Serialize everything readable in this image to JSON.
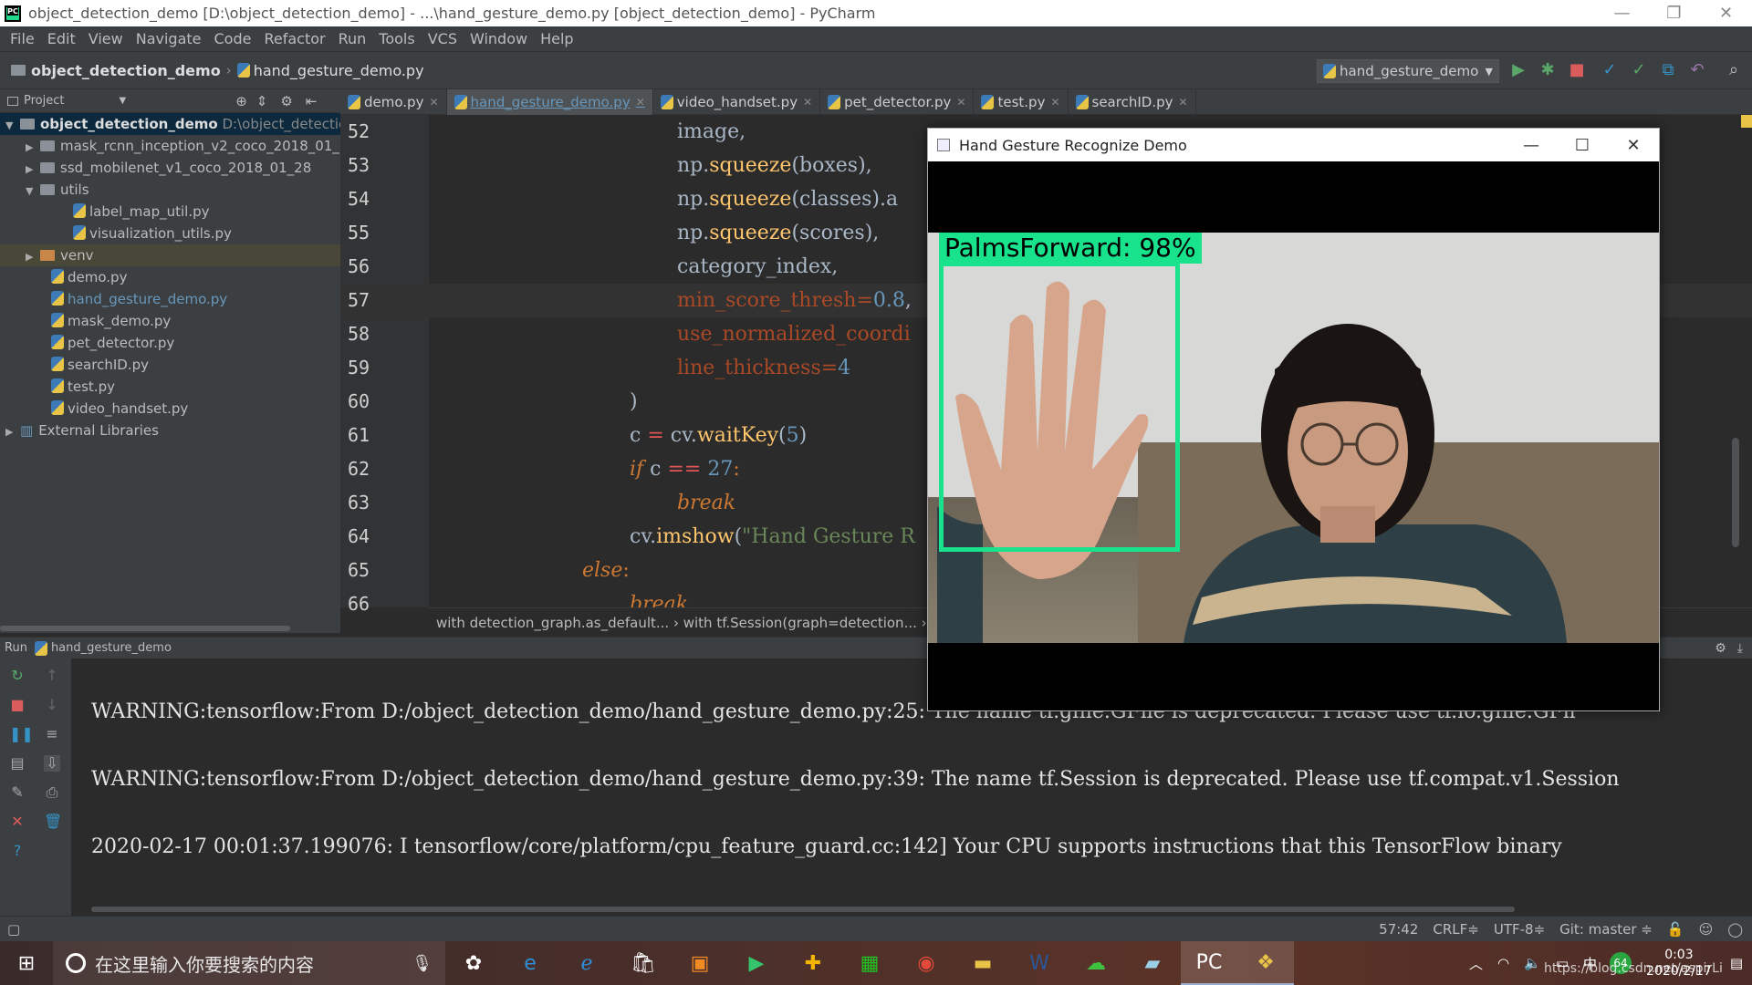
{
  "window": {
    "title": "object_detection_demo [D:\\object_detection_demo] - ...\\hand_gesture_demo.py [object_detection_demo] - PyCharm",
    "minimize": "—",
    "maximize": "❐",
    "close": "✕"
  },
  "menu": [
    "File",
    "Edit",
    "View",
    "Navigate",
    "Code",
    "Refactor",
    "Run",
    "Tools",
    "VCS",
    "Window",
    "Help"
  ],
  "navbar": {
    "project": "object_detection_demo",
    "file": "hand_gesture_demo.py",
    "run_config": "hand_gesture_demo",
    "run_config_arrow": "▼"
  },
  "project_panel": {
    "header": "Project",
    "root_name": "object_detection_demo",
    "root_path": "D:\\object_detectio",
    "items": [
      {
        "label": "mask_rcnn_inception_v2_coco_2018_01_"
      },
      {
        "label": "ssd_mobilenet_v1_coco_2018_01_28"
      },
      {
        "label": "utils"
      },
      {
        "label": "label_map_util.py"
      },
      {
        "label": "visualization_utils.py"
      },
      {
        "label": "venv"
      },
      {
        "label": "demo.py"
      },
      {
        "label": "hand_gesture_demo.py"
      },
      {
        "label": "mask_demo.py"
      },
      {
        "label": "pet_detector.py"
      },
      {
        "label": "searchID.py"
      },
      {
        "label": "test.py"
      },
      {
        "label": "video_handset.py"
      },
      {
        "label": "External Libraries"
      }
    ]
  },
  "tabs": [
    {
      "label": "demo.py"
    },
    {
      "label": "hand_gesture_demo.py"
    },
    {
      "label": "video_handset.py"
    },
    {
      "label": "pet_detector.py"
    },
    {
      "label": "test.py"
    },
    {
      "label": "searchID.py"
    }
  ],
  "editor": {
    "line_numbers": [
      "52",
      "53",
      "54",
      "55",
      "56",
      "57",
      "58",
      "59",
      "60",
      "61",
      "62",
      "63",
      "64",
      "65",
      "66"
    ],
    "code": {
      "l52": "image,",
      "l53a": "np.",
      "l53b": "squeeze",
      "l53c": "(boxes),",
      "l54a": "np.",
      "l54b": "squeeze",
      "l54c": "(classes).a",
      "l55a": "np.",
      "l55b": "squeeze",
      "l55c": "(scores),",
      "l56": "category_index,",
      "l57a": "min_score_thresh",
      "l57b": "=",
      "l57c": "0.8",
      "l57d": ",",
      "l58": "use_normalized_coordi",
      "l59a": "line_thickness",
      "l59b": "=",
      "l59c": "4",
      "l60": ")",
      "l61a": "c ",
      "l61b": "=",
      "l61c": " cv.",
      "l61d": "waitKey",
      "l61e": "(",
      "l61f": "5",
      "l61g": ")",
      "l62a": "if",
      "l62b": " c ",
      "l62c": "==",
      "l62d": " 27",
      "l62e": ":",
      "l63": "break",
      "l64a": "cv.",
      "l64b": "imshow",
      "l64c": "(",
      "l64d": "\"Hand Gesture R",
      "l65a": "else",
      "l65b": ":",
      "l66": "break"
    },
    "breadcrumb": "with detection_graph.as_default...  ›  with tf.Session(graph=detection...  ›"
  },
  "run_panel": {
    "header_prefix": "Run",
    "header_config": "hand_gesture_demo",
    "output": [
      "WARNING:tensorflow:From D:/object_detection_demo/hand_gesture_demo.py:25: The name tf.gfile.GFile is deprecated. Please use tf.io.gfile.GFil",
      "WARNING:tensorflow:From D:/object_detection_demo/hand_gesture_demo.py:39: The name tf.Session is deprecated. Please use tf.compat.v1.Session",
      "2020-02-17 00:01:37.199076: I tensorflow/core/platform/cpu_feature_guard.cc:142] Your CPU supports instructions that this TensorFlow binary"
    ]
  },
  "statusbar": {
    "position": "57:42",
    "line_sep": "CRLF≑",
    "encoding": "UTF-8≑",
    "git": "Git: master ≑"
  },
  "cv_window": {
    "title": "Hand Gesture Recognize Demo",
    "detection_label": "PalmsForward: 98%",
    "box_color": "#19e28c"
  },
  "taskbar": {
    "search_placeholder": "在这里输入你要搜索的内容",
    "time": "0:03",
    "date": "2020/2/17",
    "badge": "64",
    "watermark": "https://blog.csdn.net/aspirLi"
  },
  "colors": {
    "ide_bg": "#2b2b2b",
    "panel_bg": "#3c3f41",
    "accent_blue": "#6897bb",
    "keyword": "#cc7832",
    "function": "#ffc66d",
    "param": "#aa4926"
  }
}
